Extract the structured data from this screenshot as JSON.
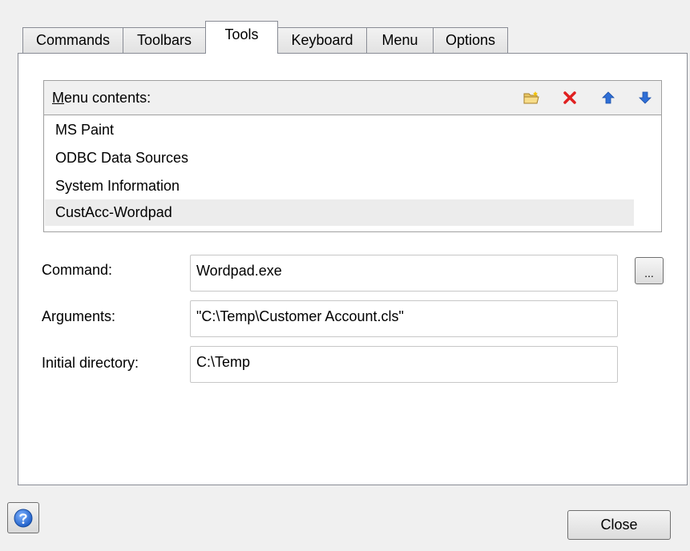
{
  "tabs": [
    "Commands",
    "Toolbars",
    "Tools",
    "Keyboard",
    "Menu",
    "Options"
  ],
  "active_tab": "Tools",
  "menu_contents": {
    "title_accel": "M",
    "title_rest": "enu contents:",
    "toolbar_icons": [
      "new-folder-icon",
      "delete-icon",
      "move-up-icon",
      "move-down-icon"
    ],
    "items": [
      "MS Paint",
      "ODBC Data Sources",
      "System Information",
      "CustAcc-Wordpad"
    ],
    "selected_item": "CustAcc-Wordpad"
  },
  "fields": {
    "command_label": "Command:",
    "command_value": "Wordpad.exe",
    "arguments_label": "Arguments:",
    "arguments_value": "\"C:\\Temp\\Customer Account.cls\"",
    "initial_dir_label": "Initial directory:",
    "initial_dir_value": "C:\\Temp",
    "browse_label": "..."
  },
  "buttons": {
    "close_label": "Close"
  },
  "colors": {
    "delete_icon": "#e02020",
    "arrow_icon": "#2f6fd6",
    "help_icon": "#1f5fc8"
  }
}
